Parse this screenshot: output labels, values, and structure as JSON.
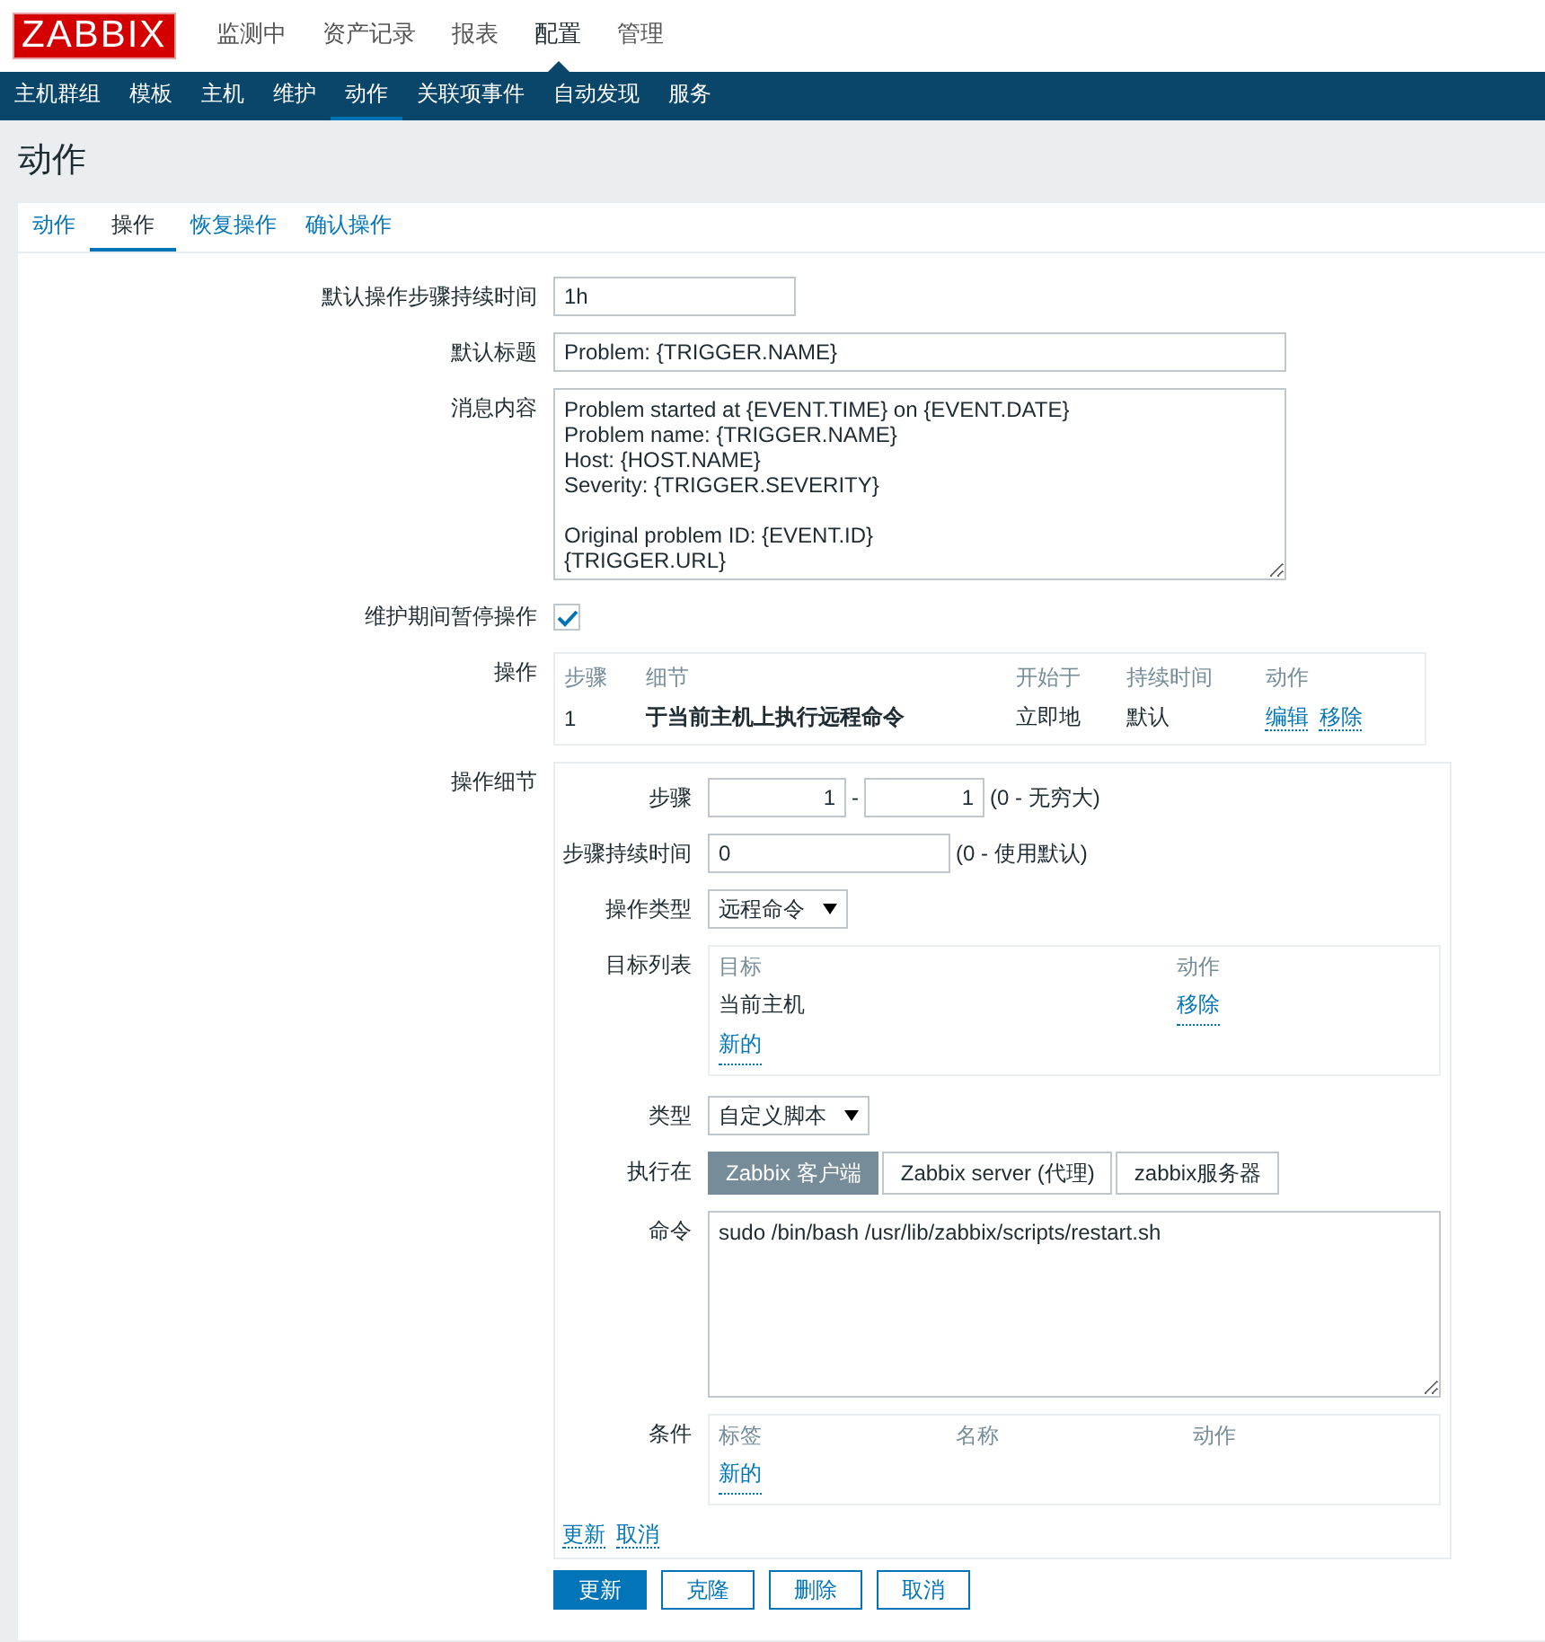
{
  "logo": "ZABBIX",
  "top_menu": [
    {
      "label": "监测中",
      "selected": false
    },
    {
      "label": "资产记录",
      "selected": false
    },
    {
      "label": "报表",
      "selected": false
    },
    {
      "label": "配置",
      "selected": true
    },
    {
      "label": "管理",
      "selected": false
    }
  ],
  "sub_menu": [
    {
      "label": "主机群组",
      "selected": false
    },
    {
      "label": "模板",
      "selected": false
    },
    {
      "label": "主机",
      "selected": false
    },
    {
      "label": "维护",
      "selected": false
    },
    {
      "label": "动作",
      "selected": true
    },
    {
      "label": "关联项事件",
      "selected": false
    },
    {
      "label": "自动发现",
      "selected": false
    },
    {
      "label": "服务",
      "selected": false
    }
  ],
  "page_title": "动作",
  "tabs": [
    {
      "label": "动作",
      "selected": false
    },
    {
      "label": "操作",
      "selected": true
    },
    {
      "label": "恢复操作",
      "selected": false
    },
    {
      "label": "确认操作",
      "selected": false
    }
  ],
  "form": {
    "default_step_duration": {
      "label": "默认操作步骤持续时间",
      "value": "1h"
    },
    "default_subject": {
      "label": "默认标题",
      "value": "Problem: {TRIGGER.NAME}"
    },
    "default_message": {
      "label": "消息内容",
      "value": "Problem started at {EVENT.TIME} on {EVENT.DATE}\nProblem name: {TRIGGER.NAME}\nHost: {HOST.NAME}\nSeverity: {TRIGGER.SEVERITY}\n\nOriginal problem ID: {EVENT.ID}\n{TRIGGER.URL}"
    },
    "pause_in_maintenance": {
      "label": "维护期间暂停操作",
      "checked": true
    },
    "operations": {
      "label": "操作",
      "columns": [
        "步骤",
        "细节",
        "开始于",
        "持续时间",
        "动作"
      ],
      "rows": [
        {
          "step": "1",
          "details": "于当前主机上执行远程命令",
          "start_in": "立即地",
          "duration": "默认",
          "actions": [
            "编辑",
            "移除"
          ]
        }
      ]
    },
    "operation_details": {
      "label": "操作细节",
      "steps": {
        "label": "步骤",
        "from": "1",
        "separator": "-",
        "to": "1",
        "hint": "(0 - 无穷大)"
      },
      "step_duration": {
        "label": "步骤持续时间",
        "value": "0",
        "hint": "(0 - 使用默认)"
      },
      "operation_type": {
        "label": "操作类型",
        "value": "远程命令"
      },
      "target_list": {
        "label": "目标列表",
        "columns": [
          "目标",
          "动作"
        ],
        "rows": [
          {
            "target": "当前主机",
            "action": "移除"
          }
        ],
        "add_link": "新的"
      },
      "type": {
        "label": "类型",
        "value": "自定义脚本"
      },
      "execute_on": {
        "label": "执行在",
        "options": [
          {
            "label": "Zabbix 客户端",
            "selected": true
          },
          {
            "label": "Zabbix server (代理)",
            "selected": false
          },
          {
            "label": "zabbix服务器",
            "selected": false
          }
        ]
      },
      "commands": {
        "label": "命令",
        "value": "sudo /bin/bash /usr/lib/zabbix/scripts/restart.sh"
      },
      "conditions": {
        "label": "条件",
        "columns": [
          "标签",
          "名称",
          "动作"
        ],
        "add_link": "新的"
      },
      "links": [
        "更新",
        "取消"
      ]
    }
  },
  "buttons": [
    {
      "label": "更新",
      "kind": "primary"
    },
    {
      "label": "克隆",
      "kind": "secondary"
    },
    {
      "label": "删除",
      "kind": "secondary"
    },
    {
      "label": "取消",
      "kind": "secondary"
    }
  ]
}
